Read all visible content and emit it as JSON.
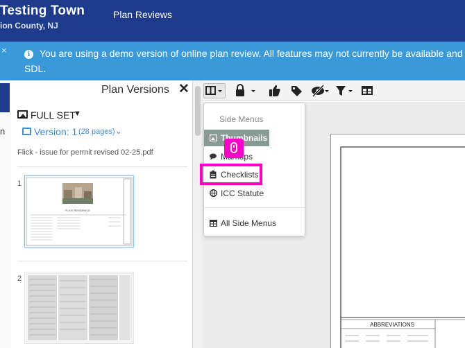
{
  "header": {
    "town": "Testing Town",
    "county": "ion County, NJ",
    "nav_plan_reviews": "Plan Reviews"
  },
  "banner": {
    "close": "×",
    "info": "i",
    "text_line1": "You are using a demo version of online plan review. All features may not currently be available and are s",
    "text_line2": "SDL."
  },
  "left_strip": {
    "fragment": "n"
  },
  "plan_versions": {
    "title": "Plan Versions",
    "close": "✕",
    "full_set_label": "FULL SET",
    "version_label": "Version: 1",
    "version_pages": "(28 pages)",
    "filename": "Flick - issue for permit revised 02-25.pdf",
    "pages": [
      {
        "number": "1",
        "title": "FLICK RESIDENCE"
      },
      {
        "number": "2"
      }
    ]
  },
  "toolbar": {
    "icons": [
      "layout-icon",
      "lock-icon",
      "thumbs-up-icon",
      "tag-icon",
      "eye-slash-icon",
      "filter-icon",
      "table-icon"
    ]
  },
  "side_menu": {
    "header": "Side Menus",
    "items": [
      {
        "label": "Thumbnails",
        "active": true
      },
      {
        "label": "Markups",
        "active": false
      },
      {
        "label": "Checklists",
        "active": false
      },
      {
        "label": "ICC Statute",
        "active": false
      }
    ],
    "all_label": "All Side Menus"
  },
  "sheet": {
    "title": "ABBREVIATIONS"
  },
  "colors": {
    "header_bg": "#1e3a8a",
    "banner_bg": "#3a9ad9",
    "link_blue": "#3a8fd6",
    "highlight": "#ff00c8",
    "active_item_bg": "#8a9a96"
  }
}
